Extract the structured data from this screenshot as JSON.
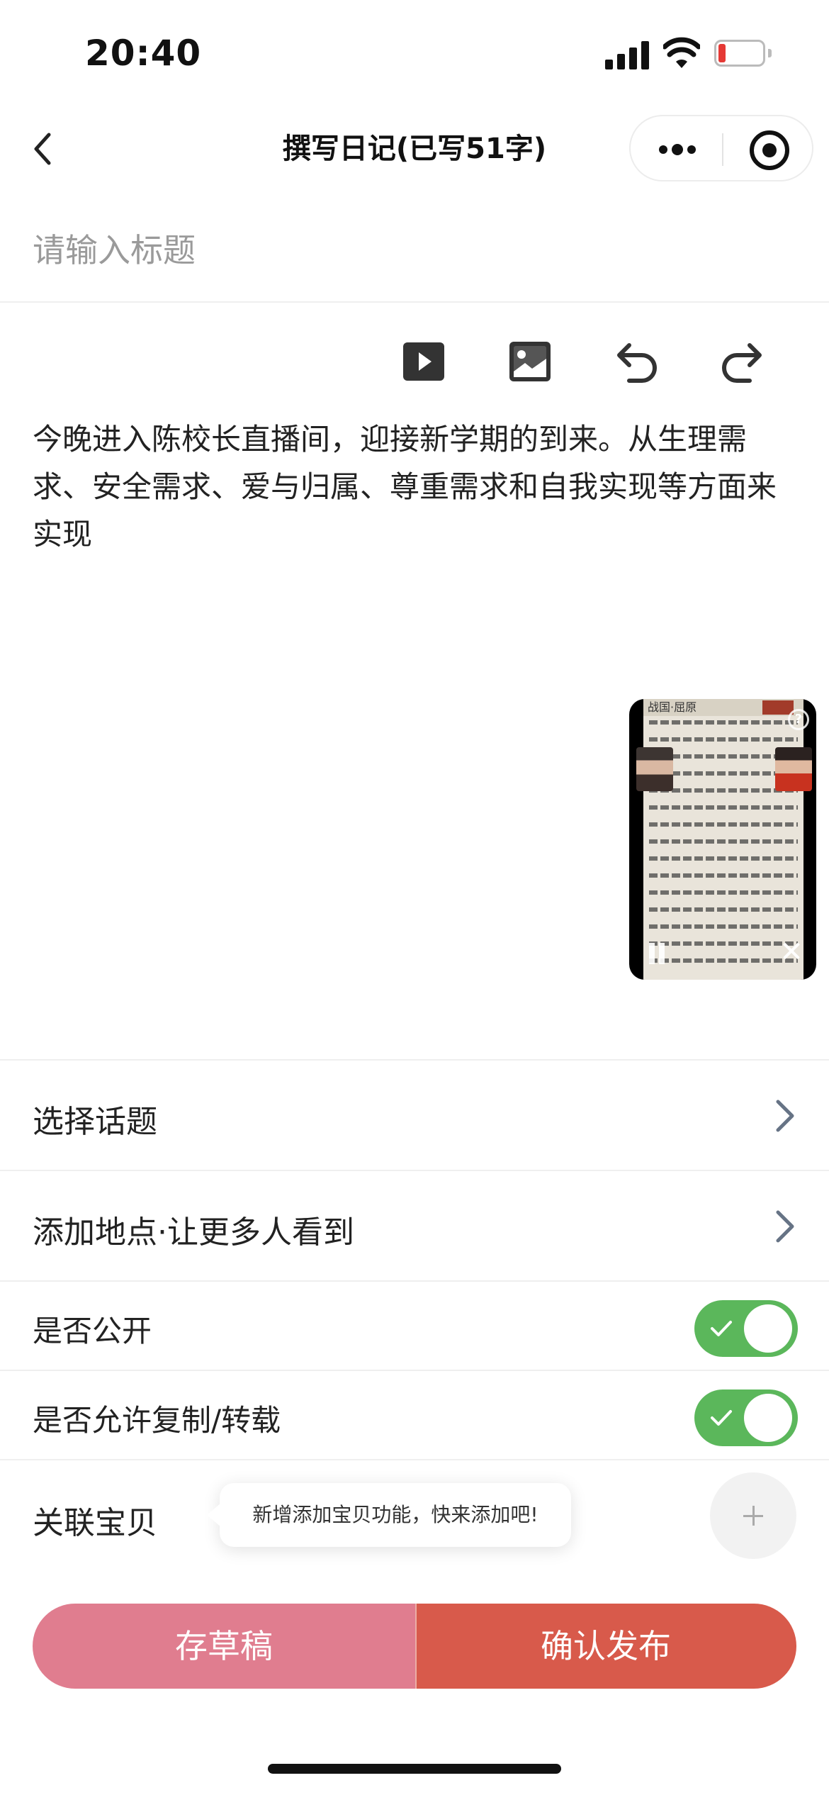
{
  "status_bar": {
    "time": "20:40",
    "icons": [
      "signal-icon",
      "wifi-icon",
      "battery-icon"
    ],
    "battery_color": "#e53935"
  },
  "nav": {
    "title": "撰写日记(已写51字)",
    "icons": [
      "back-arrow-icon",
      "more-dots-icon",
      "target-circle-icon"
    ]
  },
  "editor": {
    "title_placeholder": "请输入标题",
    "toolbar_icons": [
      "video-icon",
      "image-icon",
      "undo-icon",
      "redo-icon"
    ],
    "body": "今晚进入陈校长直播间，迎接新学期的到来。从生理需求、安全需求、爱与归属、尊重需求和自我实现等方面来实现"
  },
  "floating_video": {
    "header_text": "战国·屈原",
    "icons": [
      "help-icon",
      "pause-icon",
      "close-icon"
    ]
  },
  "settings": {
    "topic_label": "选择话题",
    "location_label": "添加地点·让更多人看到",
    "public_label": "是否公开",
    "public_on": true,
    "copy_label": "是否允许复制/转载",
    "copy_on": true,
    "baby_label": "关联宝贝",
    "baby_tip": "新增添加宝贝功能，快来添加吧!"
  },
  "actions": {
    "draft_label": "存草稿",
    "publish_label": "确认发布"
  },
  "colors": {
    "toggle_on": "#5bb75b",
    "draft_button": "#e07d8f",
    "publish_button": "#d85a4b"
  }
}
